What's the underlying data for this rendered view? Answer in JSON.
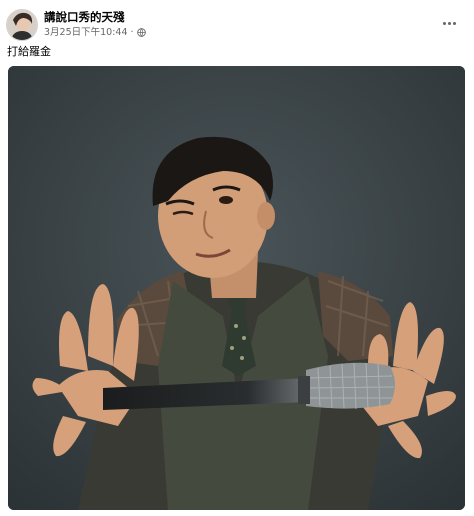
{
  "post": {
    "author_name": "講說口秀的天殘",
    "timestamp": "3月25日下午10:44",
    "separator": "·",
    "privacy_icon": "globe-icon",
    "more_icon": "more-horizontal-icon",
    "caption": "打給羅金"
  },
  "photo": {
    "subject": "man-winking-with-microphone",
    "background_color": "#3c4548"
  }
}
